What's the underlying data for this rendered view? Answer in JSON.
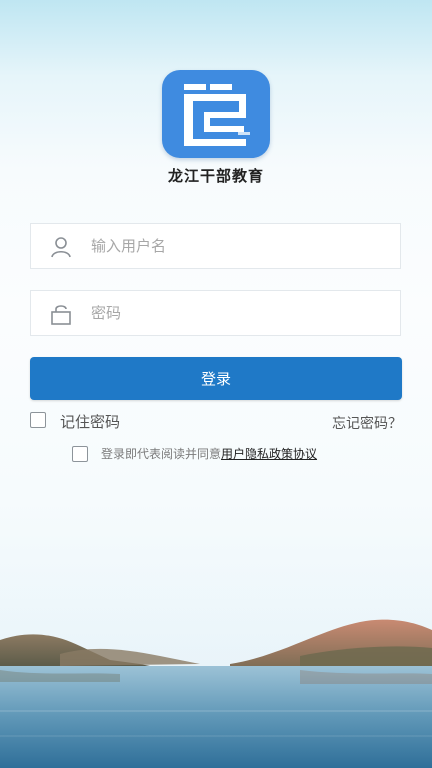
{
  "app": {
    "name": "龙江干部教育"
  },
  "login_form": {
    "username_placeholder": "输入用户名",
    "password_placeholder": "密码",
    "submit_label": "登录",
    "remember_label": "记住密码",
    "forgot_label": "忘记密码？"
  },
  "agreement": {
    "prefix": "登录即代表阅读并同意",
    "link_text": "用户隐私政策协议"
  },
  "colors": {
    "primary_button": "#1f79c7",
    "logo_background": "#3f8be0"
  },
  "icons": {
    "user_field": "user-icon",
    "password_field": "lock-icon",
    "logo": "app-logo-icon"
  }
}
